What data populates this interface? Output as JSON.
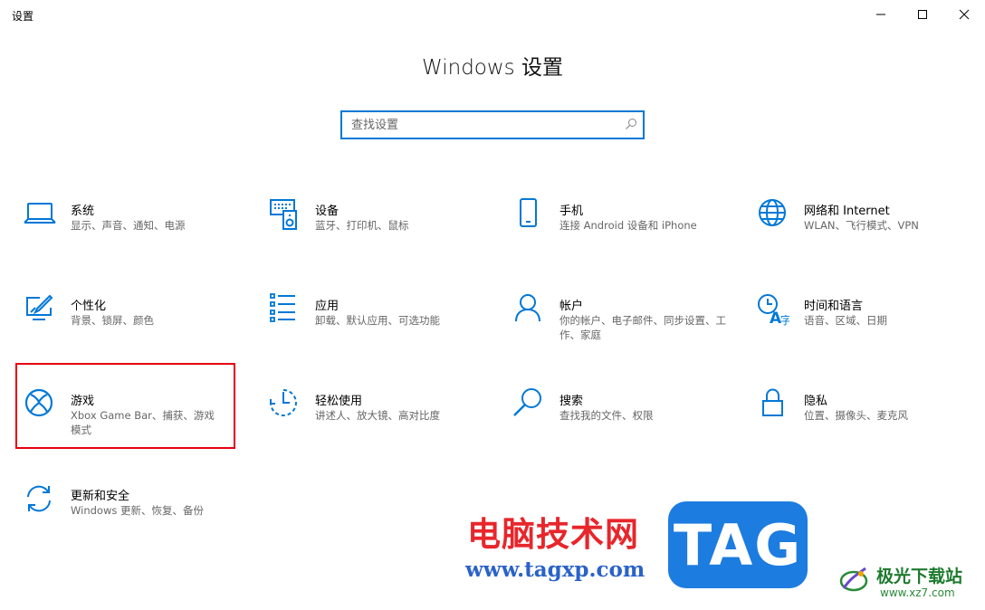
{
  "window": {
    "title": "设置"
  },
  "header": {
    "title": "Windows 设置"
  },
  "search": {
    "placeholder": "查找设置",
    "value": ""
  },
  "accent_color": "#0078d7",
  "highlight_color": "#e60012",
  "tiles": [
    {
      "name": "系统",
      "desc": "显示、声音、通知、电源",
      "icon": "laptop-icon"
    },
    {
      "name": "设备",
      "desc": "蓝牙、打印机、鼠标",
      "icon": "devices-icon"
    },
    {
      "name": "手机",
      "desc": "连接 Android 设备和 iPhone",
      "icon": "phone-icon"
    },
    {
      "name": "网络和 Internet",
      "desc": "WLAN、飞行模式、VPN",
      "icon": "globe-icon"
    },
    {
      "name": "个性化",
      "desc": "背景、锁屏、颜色",
      "icon": "paint-icon"
    },
    {
      "name": "应用",
      "desc": "卸载、默认应用、可选功能",
      "icon": "apps-list-icon"
    },
    {
      "name": "帐户",
      "desc": "你的帐户、电子邮件、同步设置、工作、家庭",
      "icon": "person-icon"
    },
    {
      "name": "时间和语言",
      "desc": "语音、区域、日期",
      "icon": "time-language-icon"
    },
    {
      "name": "游戏",
      "desc": "Xbox Game Bar、捕获、游戏模式",
      "icon": "xbox-icon"
    },
    {
      "name": "轻松使用",
      "desc": "讲述人、放大镜、高对比度",
      "icon": "ease-of-access-icon"
    },
    {
      "name": "搜索",
      "desc": "查找我的文件、权限",
      "icon": "search-icon"
    },
    {
      "name": "隐私",
      "desc": "位置、摄像头、麦克风",
      "icon": "lock-icon"
    },
    {
      "name": "更新和安全",
      "desc": "Windows 更新、恢复、备份",
      "icon": "sync-icon"
    }
  ],
  "watermark": {
    "cn_text": "电脑技术网",
    "url": "www.tagxp.com",
    "tag": "TAG",
    "site_cn": "极光下载站",
    "site_url": "www.xz7.com",
    "red": "#e8262b",
    "blue": "#1d7ce0",
    "green": "#1e7a2e"
  }
}
